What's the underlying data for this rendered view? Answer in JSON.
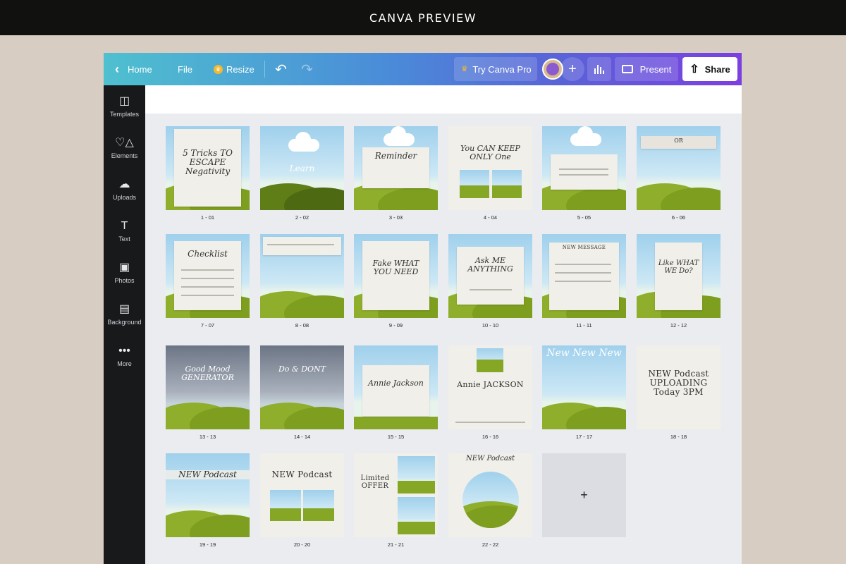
{
  "banner": {
    "title": "CANVA PREVIEW"
  },
  "toolbar": {
    "home": "Home",
    "file": "File",
    "resize": "Resize",
    "try_pro": "Try Canva Pro",
    "add_person": "+",
    "present": "Present",
    "share": "Share"
  },
  "sidebar": {
    "items": [
      {
        "label": "Templates",
        "icon": "templates-icon"
      },
      {
        "label": "Elements",
        "icon": "elements-icon"
      },
      {
        "label": "Uploads",
        "icon": "uploads-icon"
      },
      {
        "label": "Text",
        "icon": "text-icon"
      },
      {
        "label": "Photos",
        "icon": "photos-icon"
      },
      {
        "label": "Background",
        "icon": "background-icon"
      },
      {
        "label": "More",
        "icon": "more-icon"
      }
    ]
  },
  "pages": [
    {
      "label": "1 - 01",
      "heading": "5 Tricks TO ESCAPE Negativity"
    },
    {
      "label": "2 - 02",
      "heading": "Learn"
    },
    {
      "label": "3 - 03",
      "heading": "Reminder"
    },
    {
      "label": "4 - 04",
      "heading": "You CAN KEEP ONLY One"
    },
    {
      "label": "5 - 05",
      "heading": ""
    },
    {
      "label": "6 - 06",
      "heading": "OR"
    },
    {
      "label": "7 - 07",
      "heading": "Checklist"
    },
    {
      "label": "8 - 08",
      "heading": ""
    },
    {
      "label": "9 - 09",
      "heading": "Fake WHAT YOU NEED"
    },
    {
      "label": "10 - 10",
      "heading": "Ask ME ANYTHING"
    },
    {
      "label": "11 - 11",
      "heading": "NEW MESSAGE"
    },
    {
      "label": "12 - 12",
      "heading": "Like WHAT WE Do?"
    },
    {
      "label": "13 - 13",
      "heading": "Good Mood GENERATOR"
    },
    {
      "label": "14 - 14",
      "heading": "Do & DONT"
    },
    {
      "label": "15 - 15",
      "heading": "Annie Jackson"
    },
    {
      "label": "16 - 16",
      "heading": "Annie JACKSON"
    },
    {
      "label": "17 - 17",
      "heading": "New New New"
    },
    {
      "label": "18 - 18",
      "heading": "NEW Podcast UPLOADING Today 3PM"
    },
    {
      "label": "19 - 19",
      "heading": "NEW Podcast"
    },
    {
      "label": "20 - 20",
      "heading": "NEW Podcast"
    },
    {
      "label": "21 - 21",
      "heading": "Limited OFFER"
    },
    {
      "label": "22 - 22",
      "heading": "NEW Podcast"
    }
  ],
  "add_page": "+"
}
